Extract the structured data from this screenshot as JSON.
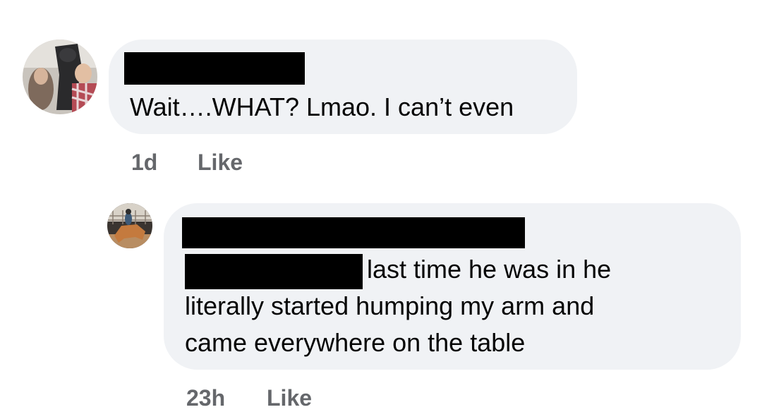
{
  "comments": [
    {
      "author_redacted": true,
      "avatar_icon": "user-avatar-horse-photo",
      "text": "Wait….WHAT? Lmao. I can’t even",
      "timestamp": "1d",
      "like_label": "Like"
    },
    {
      "author_redacted": true,
      "avatar_icon": "user-avatar-rider-photo",
      "text_line1": "last time he was in he",
      "text_line2": "literally started humping my arm and",
      "text_line3": "came everywhere on the table",
      "timestamp": "23h",
      "like_label": "Like"
    }
  ],
  "colors": {
    "bubble_bg": "#f0f2f5",
    "meta_text": "#65676b",
    "body_text": "#050505",
    "redaction": "#000000"
  }
}
